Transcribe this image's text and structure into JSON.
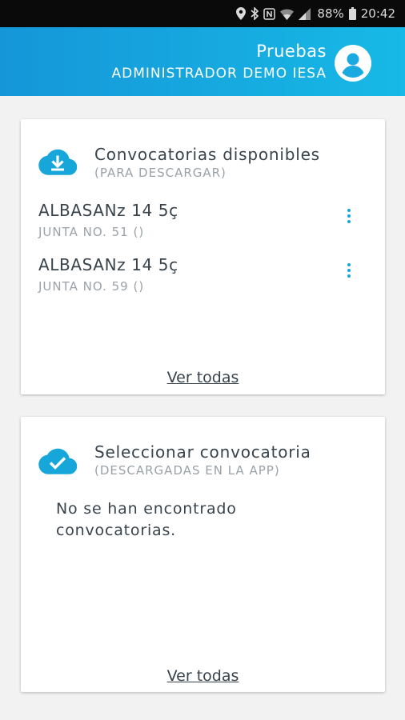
{
  "status_bar": {
    "battery": "88%",
    "time": "20:42",
    "icons": [
      "location-icon",
      "bluetooth-icon",
      "nfc-icon",
      "wifi-icon",
      "signal-icon",
      "battery-icon"
    ]
  },
  "header": {
    "title": "Pruebas",
    "subtitle": "ADMINISTRADOR DEMO IESA",
    "avatar_icon": "account-circle-icon",
    "color_start": "#1596d8",
    "color_end": "#17b9e6"
  },
  "available_card": {
    "icon": "cloud-download-icon",
    "title": "Convocatorias disponibles",
    "subtitle": "(PARA DESCARGAR)",
    "items": [
      {
        "title": "ALBASANz 14 5ç",
        "subtitle": "JUNTA NO. 51 ()"
      },
      {
        "title": "ALBASANz 14 5ç",
        "subtitle": "JUNTA NO. 59 ()"
      }
    ],
    "link": "Ver todas"
  },
  "selected_card": {
    "icon": "cloud-done-icon",
    "title": "Seleccionar convocatoria",
    "subtitle": "(DESCARGADAS EN LA APP)",
    "empty_message": "No se han encontrado convocatorias.",
    "link": "Ver todas"
  },
  "colors": {
    "accent": "#17a6d9",
    "text": "#38434c",
    "muted": "#9aa2a8"
  }
}
